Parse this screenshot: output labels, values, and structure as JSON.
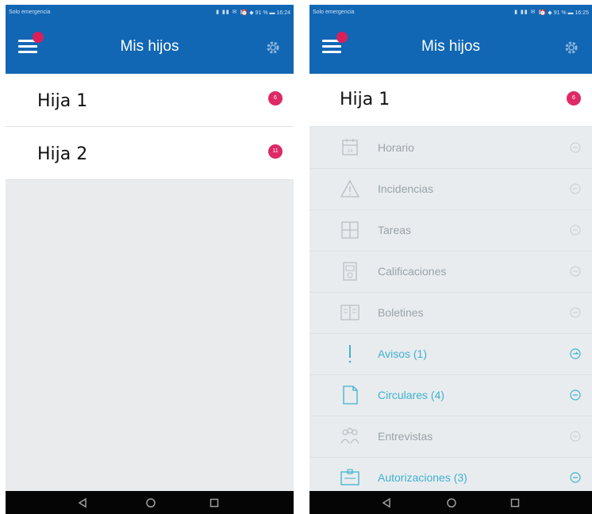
{
  "status_bar": {
    "carrier": "Solo emergencia",
    "left_screen_time": "16:24",
    "right_screen_time": "16:25",
    "battery": "91 %"
  },
  "app_bar": {
    "title": "Mis hijos",
    "menu_icon": "hamburger-menu-icon",
    "settings_icon": "gear-icon",
    "accent_color": "#1167b4",
    "badge_color": "#d91f59"
  },
  "left_screen": {
    "children": [
      {
        "name": "Hija 1",
        "count": "6"
      },
      {
        "name": "Hija 2",
        "count": "11"
      }
    ]
  },
  "right_screen": {
    "expanded_child": {
      "name": "Hija 1",
      "count": "6"
    },
    "menu_items": [
      {
        "label": "Horario",
        "icon": "calendar-icon",
        "active": false
      },
      {
        "label": "Incidencias",
        "icon": "warning-icon",
        "active": false
      },
      {
        "label": "Tareas",
        "icon": "tasks-grid-icon",
        "active": false
      },
      {
        "label": "Calificaciones",
        "icon": "grades-document-icon",
        "active": false
      },
      {
        "label": "Boletines",
        "icon": "report-book-icon",
        "active": false
      },
      {
        "label": "Avisos (1)",
        "icon": "exclamation-icon",
        "active": true
      },
      {
        "label": "Circulares (4)",
        "icon": "document-icon",
        "active": true
      },
      {
        "label": "Entrevistas",
        "icon": "people-icon",
        "active": false
      },
      {
        "label": "Autorizaciones (3)",
        "icon": "authorization-icon",
        "active": true
      }
    ],
    "inactive_color": "#b8bfc4",
    "active_color": "#3fb1cf"
  },
  "nav_bar": {
    "back_icon": "back-triangle-icon",
    "home_icon": "home-circle-icon",
    "recents_icon": "recents-square-icon"
  }
}
